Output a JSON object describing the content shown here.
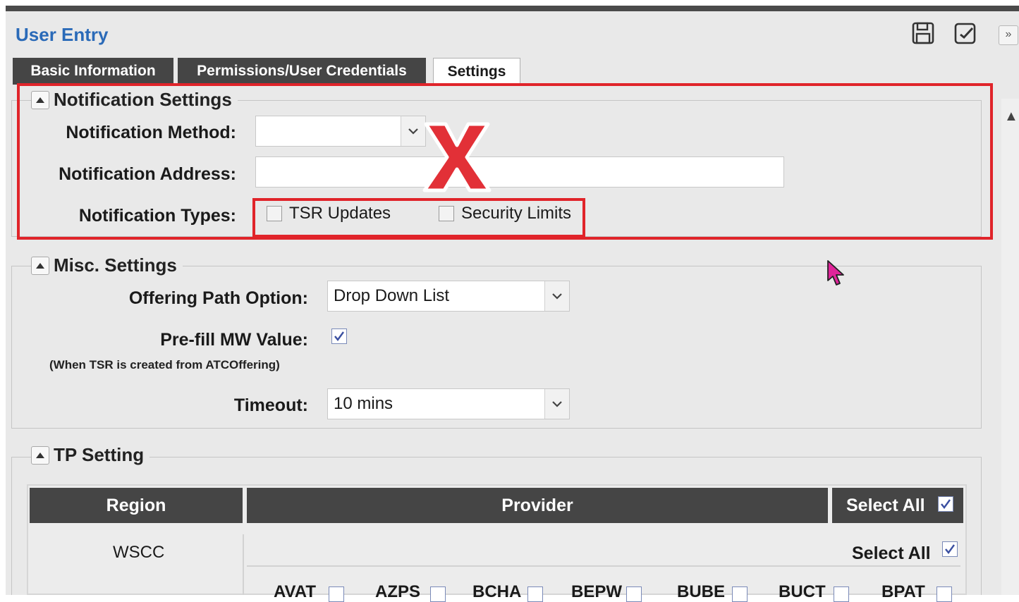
{
  "header": {
    "title": "User Entry"
  },
  "tabs": [
    {
      "label": "Basic Information"
    },
    {
      "label": "Permissions/User Credentials"
    },
    {
      "label": "Settings"
    }
  ],
  "notification": {
    "legend": "Notification Settings",
    "method_label": "Notification Method:",
    "method_value": "",
    "address_label": "Notification Address:",
    "address_value": "",
    "types_label": "Notification Types:",
    "types": [
      {
        "label": "TSR Updates",
        "checked": false
      },
      {
        "label": "Security Limits",
        "checked": false
      }
    ],
    "overlay_mark": "X"
  },
  "misc": {
    "legend": "Misc. Settings",
    "offering_label": "Offering Path Option:",
    "offering_value": "Drop Down List",
    "prefill_label": "Pre-fill MW Value:",
    "prefill_note": "(When TSR is created from ATCOffering)",
    "prefill_checked": true,
    "timeout_label": "Timeout:",
    "timeout_value": "10 mins"
  },
  "tp": {
    "legend": "TP Setting",
    "col_region": "Region",
    "col_provider": "Provider",
    "select_all_header": "Select All",
    "region": "WSCC",
    "select_all_row": "Select All",
    "providers": [
      "AVAT",
      "AZPS",
      "BCHA",
      "BEPW",
      "BUBE",
      "BUCT",
      "BPAT"
    ]
  },
  "colors": {
    "accent_title": "#2a6ab8",
    "tab_dark": "#454545",
    "highlight_red": "#e0242a",
    "cursor": "#e0249a"
  }
}
